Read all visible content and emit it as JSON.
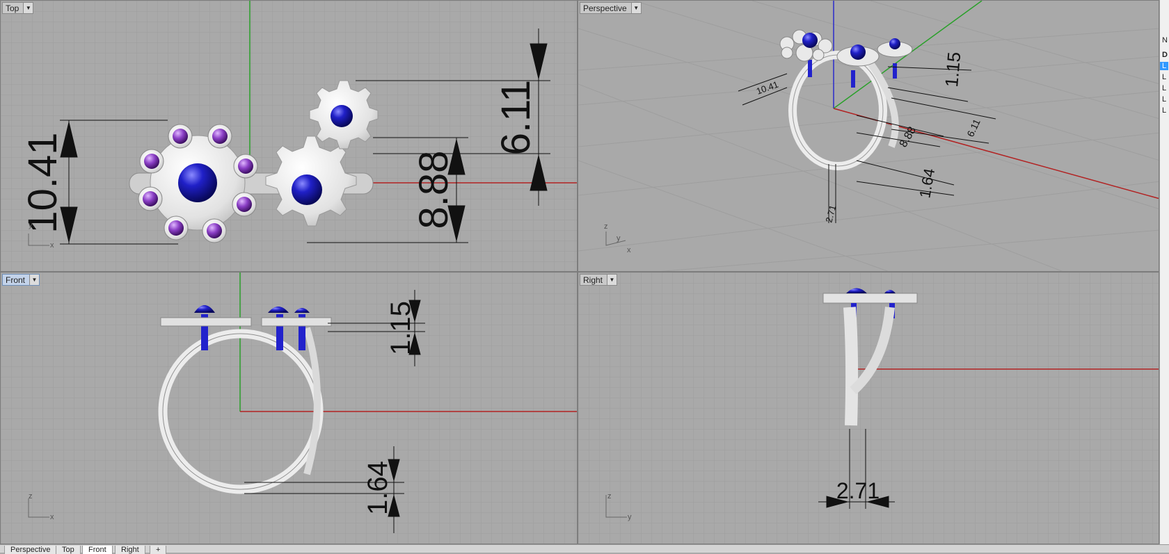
{
  "viewports": {
    "top": {
      "label": "Top",
      "dims": {
        "d1": "10.41",
        "d2": "8.88",
        "d3": "6.11"
      },
      "axes": {
        "a": "y",
        "b": "x"
      }
    },
    "perspective": {
      "label": "Perspective",
      "dims": {
        "d1": "10.41",
        "d2": "1.15",
        "d3": "8.88",
        "d4": "6.11",
        "d5": "1.64",
        "d6": "2.71"
      },
      "axes": {
        "a": "z",
        "b": "y",
        "c": "x"
      }
    },
    "front": {
      "label": "Front",
      "dims": {
        "d1": "1.15",
        "d2": "1.64"
      },
      "axes": {
        "a": "z",
        "b": "x"
      }
    },
    "right": {
      "label": "Right",
      "dims": {
        "d1": "2.71"
      },
      "axes": {
        "a": "z",
        "b": "y"
      }
    }
  },
  "tabs": [
    "Perspective",
    "Top",
    "Front",
    "Right",
    "+"
  ],
  "active_tab": "Front",
  "right_panel": [
    "N",
    "D",
    "L",
    "L",
    "L",
    "L",
    "L"
  ],
  "colors": {
    "grid_bg": "#a9a9a9",
    "grid_line": "#9c9c9c",
    "x_axis": "#b22222",
    "y_axis": "#2aa02a",
    "metal": "#e6e6e6",
    "gem_blue": "#1a1ab8",
    "gem_purple": "#8a3cc2"
  }
}
